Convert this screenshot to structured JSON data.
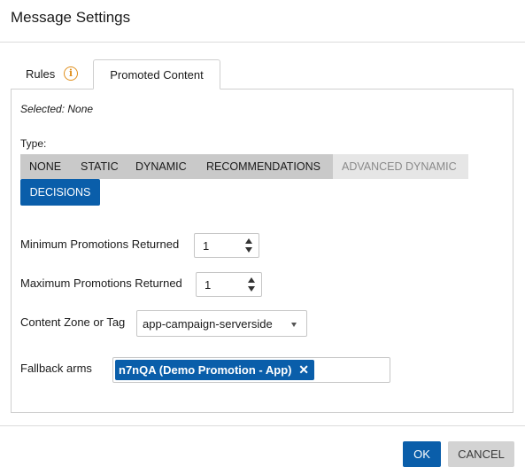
{
  "dialog": {
    "title": "Message Settings"
  },
  "tabs": {
    "rules_label": "Rules",
    "rules_icon": "info-icon",
    "promoted_label": "Promoted Content",
    "active": "Promoted Content"
  },
  "panel": {
    "selected_text": "Selected: None",
    "type_label": "Type:",
    "type_options": [
      {
        "label": "NONE",
        "enabled": true
      },
      {
        "label": "STATIC",
        "enabled": true
      },
      {
        "label": "DYNAMIC",
        "enabled": true
      },
      {
        "label": "RECOMMENDATIONS",
        "enabled": true
      },
      {
        "label": "ADVANCED DYNAMIC",
        "enabled": false
      },
      {
        "label": "DECISIONS",
        "enabled": true,
        "selected": true
      }
    ],
    "min_promotions": {
      "label": "Minimum Promotions Returned",
      "value": "1"
    },
    "max_promotions": {
      "label": "Maximum Promotions Returned",
      "value": "1"
    },
    "content_zone": {
      "label": "Content Zone or Tag",
      "value": "app-campaign-serverside"
    },
    "fallback": {
      "label": "Fallback arms",
      "chips": [
        "n7nQA (Demo Promotion - App)"
      ],
      "chip_close_glyph": "✕"
    }
  },
  "footer": {
    "ok_label": "OK",
    "cancel_label": "CANCEL"
  },
  "colors": {
    "primary": "#0a5eaa",
    "info_icon": "#e0901e",
    "type_group_bg": "#c9c9c9",
    "disabled_bg": "#e6e6e6",
    "cancel_bg": "#d3d3d3"
  }
}
